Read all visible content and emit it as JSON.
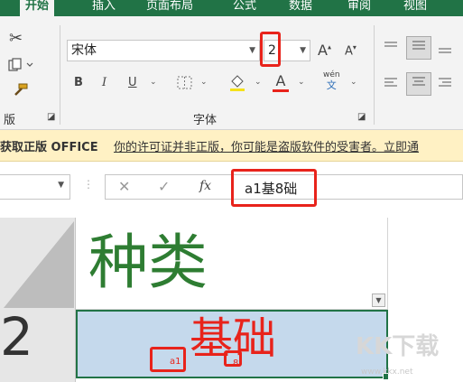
{
  "ribbon_tabs": [
    "开始",
    "插入",
    "页面布局",
    "公式",
    "数据",
    "审阅",
    "视图"
  ],
  "clipboard": {
    "group_label": "版"
  },
  "font": {
    "name": "宋体",
    "size": "2",
    "grow_label": "A",
    "shrink_label": "A",
    "bold": "B",
    "italic": "I",
    "underline": "U",
    "font_color_label": "A",
    "phonetic_top": "wén",
    "phonetic_bottom": "文",
    "group_label": "字体"
  },
  "message_bar": {
    "title": "获取正版 OFFICE",
    "text": "你的许可证并非正版，你可能是盗版软件的受害者。立即通"
  },
  "formula_bar": {
    "cancel": "✕",
    "enter": "✓",
    "fx": "fx",
    "content": "a1基8础"
  },
  "sheet": {
    "header_cell": "种类",
    "row_number": "2",
    "cell_main": "基础",
    "cell_sub": "a1",
    "cell_sup": "8"
  },
  "watermark": {
    "brand": "KK下载",
    "url": "www.kkx.net"
  },
  "colors": {
    "excel_green": "#217346",
    "header_text_green": "#2e7d32",
    "cell_text_red": "#e8231b",
    "selected_fill": "#c5d9ec"
  }
}
